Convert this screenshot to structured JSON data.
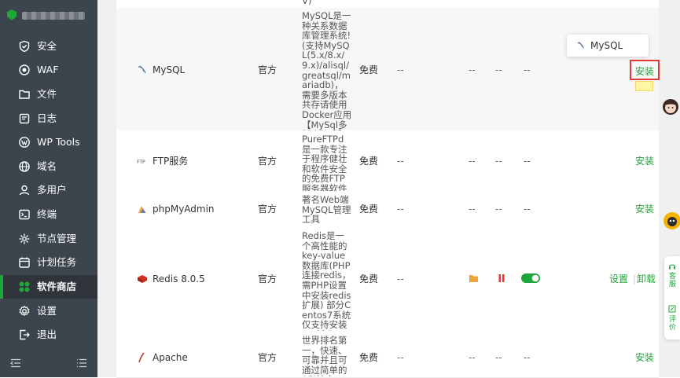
{
  "sidebar": {
    "items": [
      {
        "label": "安全",
        "icon": "shield-icon"
      },
      {
        "label": "WAF",
        "icon": "waf-icon"
      },
      {
        "label": "文件",
        "icon": "folder-icon"
      },
      {
        "label": "日志",
        "icon": "log-icon"
      },
      {
        "label": "WP Tools",
        "icon": "wordpress-icon"
      },
      {
        "label": "域名",
        "icon": "globe-icon"
      },
      {
        "label": "多用户",
        "icon": "user-icon"
      },
      {
        "label": "终端",
        "icon": "terminal-icon"
      },
      {
        "label": "节点管理",
        "icon": "node-icon"
      },
      {
        "label": "计划任务",
        "icon": "calendar-icon"
      },
      {
        "label": "软件商店",
        "icon": "grid-icon"
      },
      {
        "label": "设置",
        "icon": "gear-icon"
      },
      {
        "label": "退出",
        "icon": "logout-icon"
      }
    ],
    "active": "软件商店"
  },
  "table": {
    "rows": [
      {
        "name": "MySQL",
        "icon": "mysql-icon",
        "developer": "官方",
        "description": "MySQL是一种关系数据库管理系统!(支持MySQL(5.x/8.x/9.x)/alisql/greatsql/mariadb)，需要多版本共存请使用Docker应用【MySql多版本管理】插件",
        "price": "免费",
        "expire": "--",
        "location": "--",
        "status": "--",
        "home": "--",
        "action": "安装"
      },
      {
        "name": "FTP服务",
        "icon": "ftp-icon",
        "developer": "官方",
        "description": "PureFTPd是一款专注于程序健壮和软件安全的免费FTP服务器软件",
        "price": "免费",
        "expire": "--",
        "location": "--",
        "status": "--",
        "home": "--",
        "action": "安装"
      },
      {
        "name": "phpMyAdmin",
        "icon": "phpmyadmin-icon",
        "developer": "官方",
        "description": "著名Web端MySQL管理工具",
        "price": "免费",
        "expire": "--",
        "location": "--",
        "status": "--",
        "home": "--",
        "action": "安装"
      },
      {
        "name": "Redis 8.0.5",
        "icon": "redis-icon",
        "developer": "官方",
        "description": "Redis是一个高性能的key-value数据库(PHP连接redis，需PHP设置中安装redis扩展) 部分Centos7系统仅支持安装5.x版本",
        "price": "免费",
        "expire": "--",
        "settings": "设置",
        "uninstall": "卸载",
        "separator": "|"
      },
      {
        "name": "Apache",
        "icon": "apache-icon",
        "developer": "官方",
        "description": "世界排名第一，快速、可靠并且可通过简单的API扩充",
        "price": "免费",
        "expire": "--",
        "location": "--",
        "status": "--",
        "home": "--",
        "action": "安装"
      }
    ],
    "top_fragment": "V)"
  },
  "tooltip": {
    "text": "MySQL",
    "icon": "mysql-icon"
  },
  "highlight": {
    "label": "安装"
  },
  "float_bar": {
    "service": "客服",
    "review": "评价"
  },
  "colors": {
    "accent": "#20a53a",
    "sidebar": "#3c444d",
    "highlight_border": "#e53935"
  }
}
